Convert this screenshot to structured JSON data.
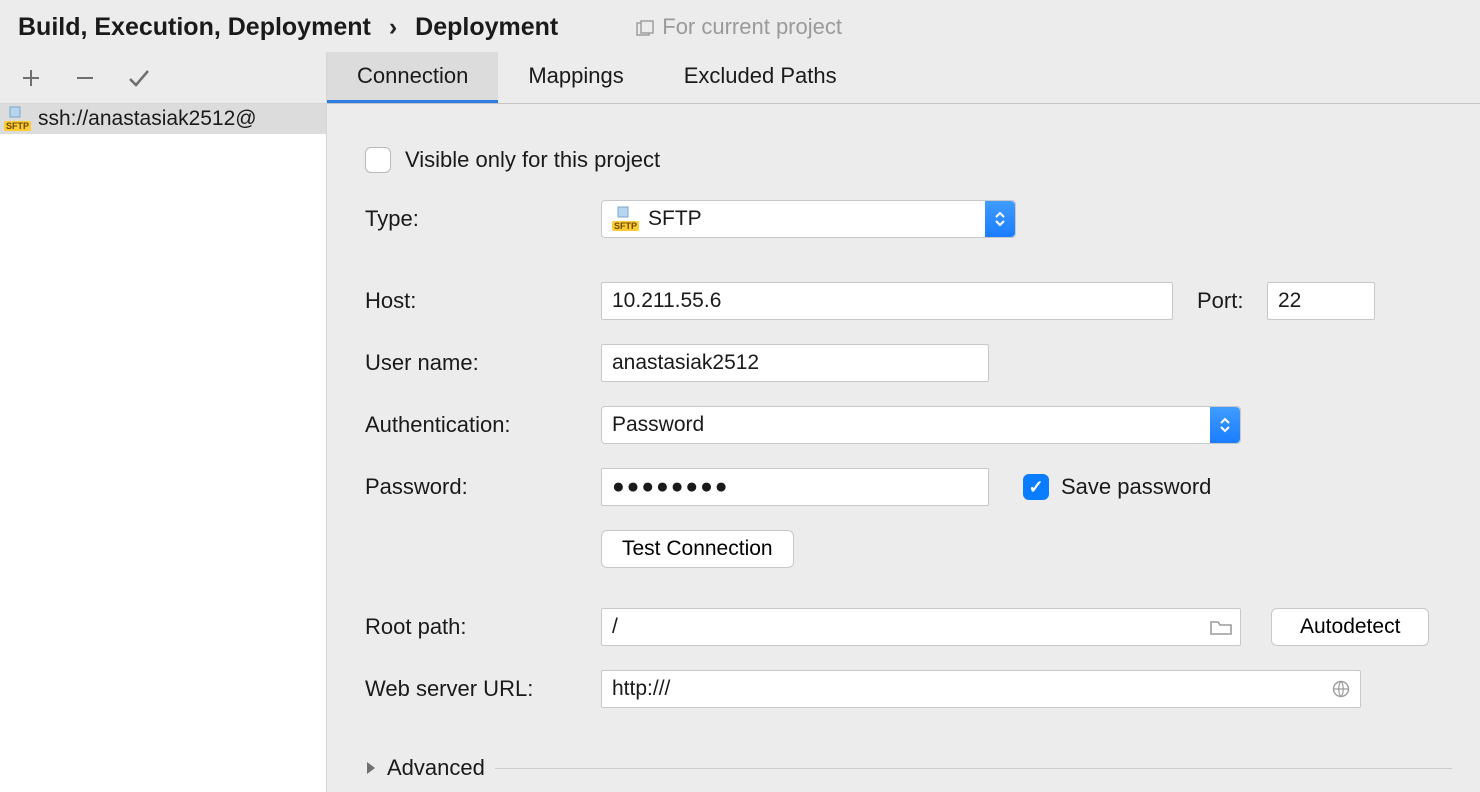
{
  "breadcrumb": {
    "group": "Build, Execution, Deployment",
    "sep": "›",
    "page": "Deployment"
  },
  "header": {
    "for_project": "For current project"
  },
  "sidebar": {
    "servers": [
      {
        "label": "ssh://anastasiak2512@"
      }
    ]
  },
  "tabs": [
    {
      "id": "connection",
      "label": "Connection",
      "active": true
    },
    {
      "id": "mappings",
      "label": "Mappings",
      "active": false
    },
    {
      "id": "excluded",
      "label": "Excluded Paths",
      "active": false
    }
  ],
  "form": {
    "visible_only_label": "Visible only for this project",
    "visible_only_checked": false,
    "type_label": "Type:",
    "type_value": "SFTP",
    "host_label": "Host:",
    "host_value": "10.211.55.6",
    "port_label": "Port:",
    "port_value": "22",
    "user_label": "User name:",
    "user_value": "anastasiak2512",
    "auth_label": "Authentication:",
    "auth_value": "Password",
    "pw_label": "Password:",
    "pw_masked": "●●●●●●●●",
    "save_pw_label": "Save password",
    "save_pw_checked": true,
    "test_btn": "Test Connection",
    "root_label": "Root path:",
    "root_value": "/",
    "autodetect_btn": "Autodetect",
    "weburl_label": "Web server URL:",
    "weburl_value": "http:///",
    "advanced_label": "Advanced"
  }
}
